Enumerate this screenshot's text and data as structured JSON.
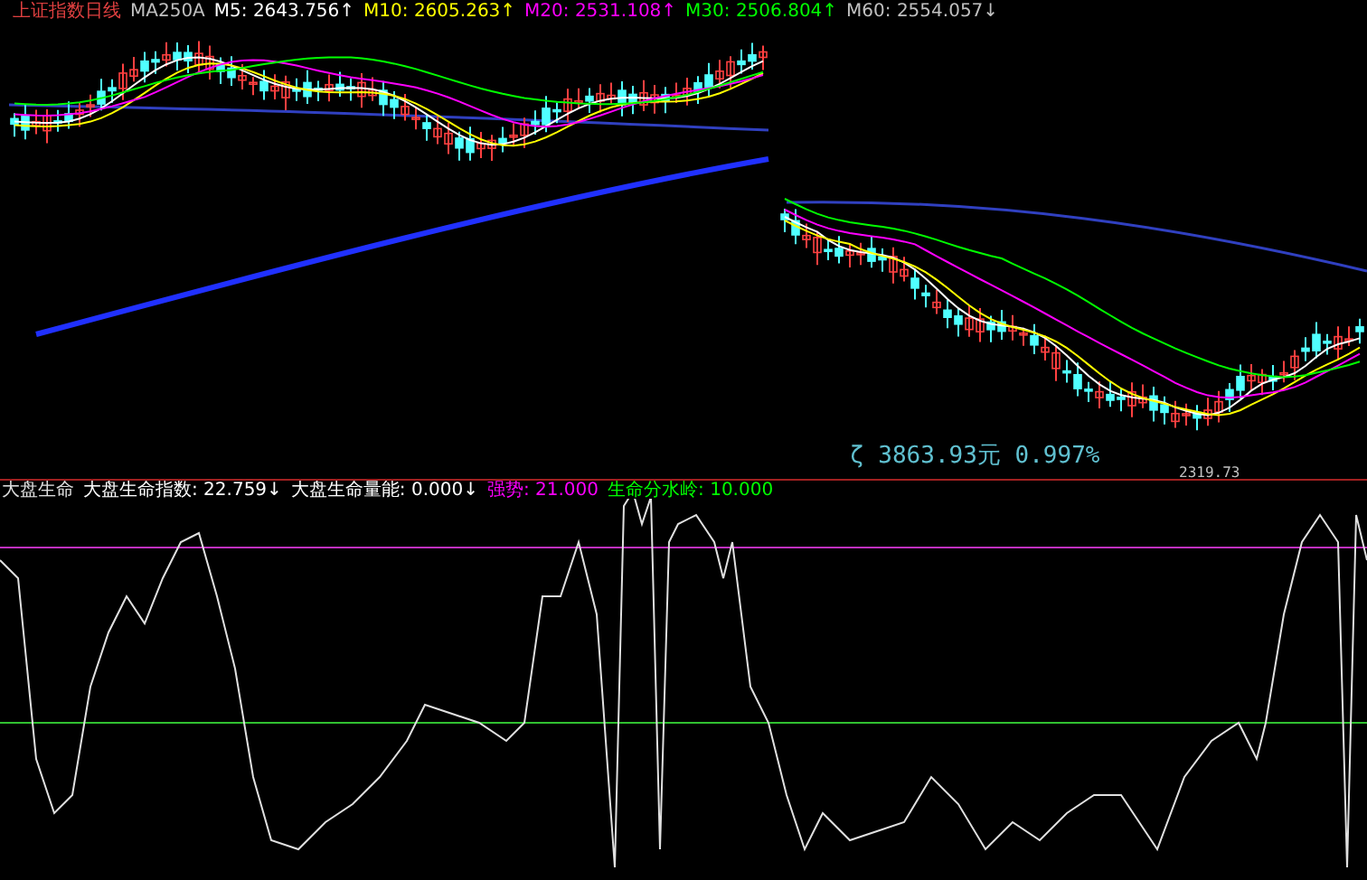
{
  "price_panel": {
    "title": "上证指数日线",
    "labels": [
      {
        "text": "MA250A",
        "color": "#c0c0c0"
      },
      {
        "text": "M5: 2643.756↑",
        "color": "#ffffff"
      },
      {
        "text": "M10: 2605.263↑",
        "color": "#ffff00"
      },
      {
        "text": "M20: 2531.108↑",
        "color": "#ff00ff"
      },
      {
        "text": "M30: 2506.804↑",
        "color": "#00ff00"
      },
      {
        "text": "M60: 2554.057↓",
        "color": "#c0c0c0"
      }
    ],
    "high_marker": "ζ 3863.93元 0.997%",
    "low_marker": "2319.73"
  },
  "indicator_panel": {
    "title": "大盘生命",
    "labels": [
      {
        "text": "大盘生命指数: 22.759↓",
        "color": "#ffffff"
      },
      {
        "text": "大盘生命量能: 0.000↓",
        "color": "#ffffff"
      },
      {
        "text": "强势: 21.000",
        "color": "#ff00ff"
      },
      {
        "text": "生命分水岭: 10.000",
        "color": "#00ff00"
      }
    ]
  }
}
